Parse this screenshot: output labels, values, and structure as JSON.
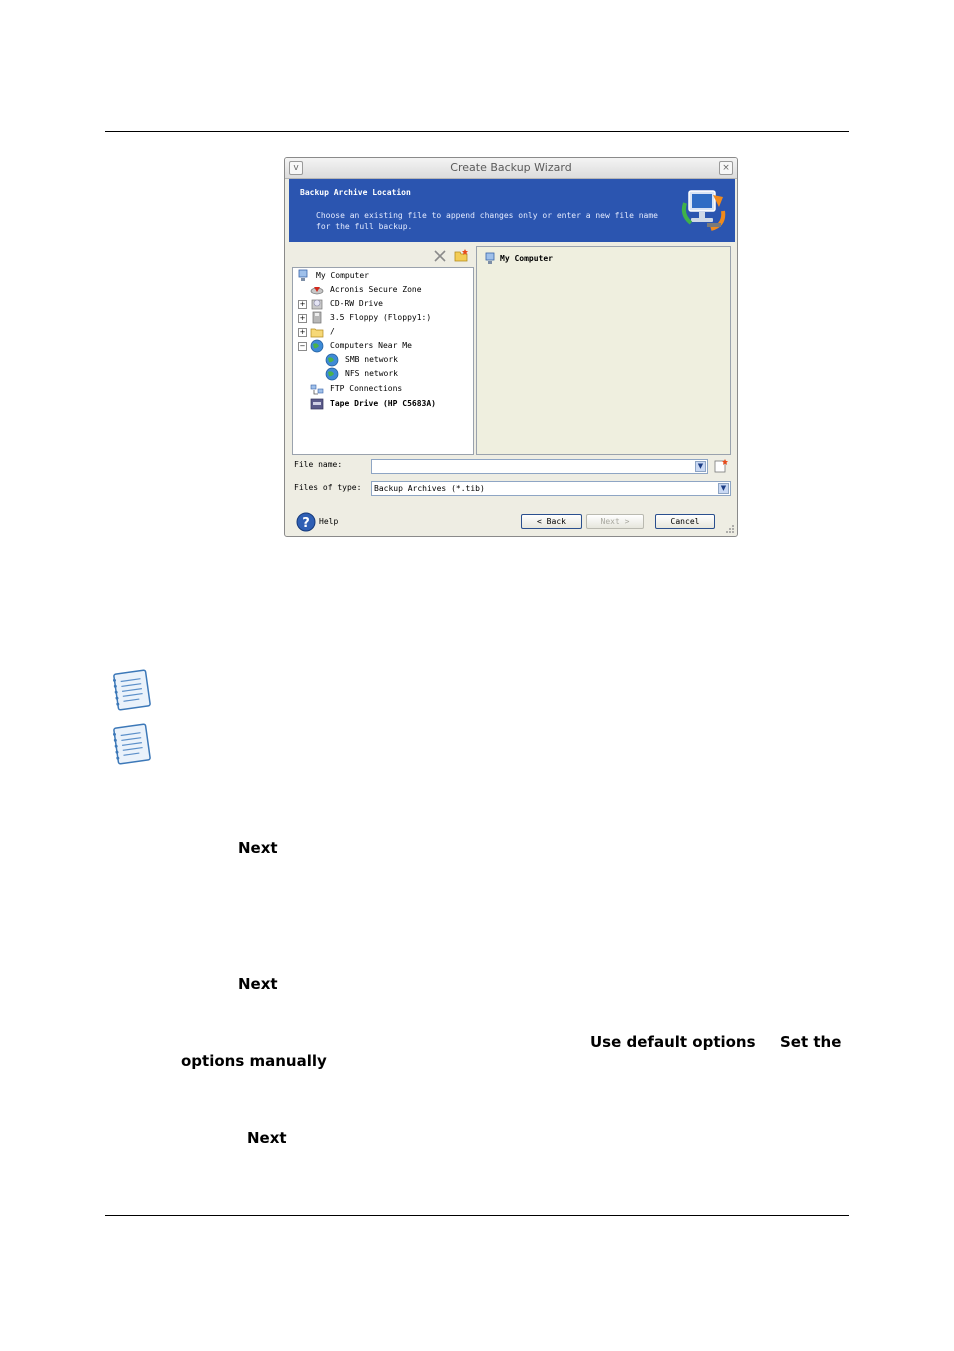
{
  "dialog": {
    "title": "Create Backup Wizard",
    "minimize_glyph": "v",
    "close_glyph": "×",
    "banner_title": "Backup Archive Location",
    "banner_description": "Choose an existing file to append changes only or enter a new file name for the full backup.",
    "toolbar_icons": [
      "delete-icon",
      "new-folder-icon"
    ],
    "tree": [
      {
        "label": "My Computer",
        "icon": "computer-icon",
        "expander": ""
      },
      {
        "label": "Acronis Secure Zone",
        "icon": "secure-zone-icon",
        "expander": ""
      },
      {
        "label": "CD-RW Drive",
        "icon": "cd-drive-icon",
        "expander": "+"
      },
      {
        "label": "3.5 Floppy (Floppy1:)",
        "icon": "floppy-icon",
        "expander": "+"
      },
      {
        "label": "/",
        "icon": "folder-icon",
        "expander": "+"
      },
      {
        "label": "Computers Near Me",
        "icon": "network-globe-icon",
        "expander": "−"
      },
      {
        "label": "SMB network",
        "icon": "network-globe-icon",
        "expander": ""
      },
      {
        "label": "NFS network",
        "icon": "network-globe-icon",
        "expander": ""
      },
      {
        "label": "FTP Connections",
        "icon": "ftp-icon",
        "expander": ""
      },
      {
        "label": "Tape Drive (HP C5683A)",
        "icon": "tape-drive-icon",
        "expander": ""
      }
    ],
    "right_pane_item": "My Computer",
    "file_name_label": "File name:",
    "file_name_value": "",
    "files_of_type_label": "Files of type:",
    "files_of_type_value": "Backup Archives (*.tib)",
    "help_label": "Help",
    "back_label": "< Back",
    "next_label": "Next >",
    "cancel_label": "Cancel"
  },
  "page": {
    "step1_next": "Next",
    "step2_next": "Next",
    "use_default_options": "Use default options",
    "set_the": "Set the",
    "options_manually": "options manually",
    "step3_next": "Next"
  }
}
